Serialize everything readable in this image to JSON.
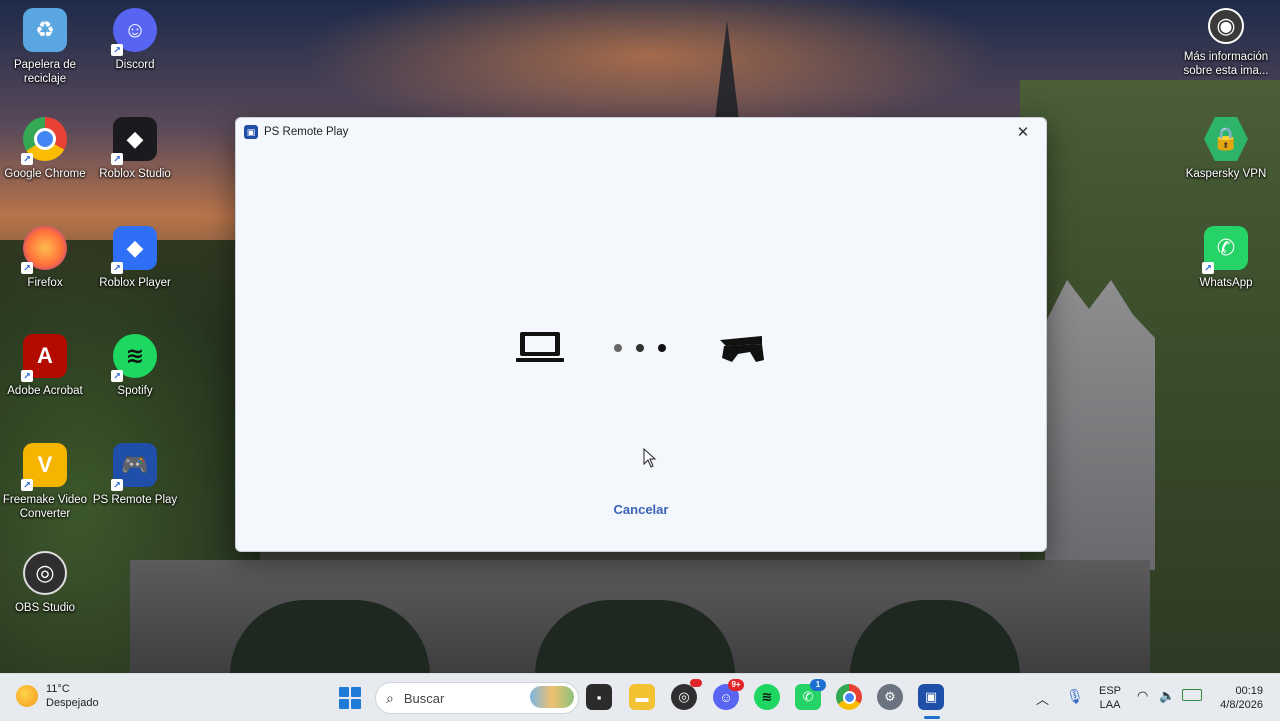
{
  "desktop": {
    "icons_left": [
      {
        "label": "Papelera de reciclaje",
        "icon": "recycle-bin-icon",
        "color": "#5aa6e0"
      },
      {
        "label": "Discord",
        "icon": "discord-icon",
        "color": "#5865F2"
      },
      {
        "label": "Google Chrome",
        "icon": "chrome-icon",
        "color": "#e94235"
      },
      {
        "label": "Roblox Studio",
        "icon": "roblox-studio-icon",
        "color": "#1b1b1f"
      },
      {
        "label": "Firefox",
        "icon": "firefox-icon",
        "color": "#ff7139"
      },
      {
        "label": "Roblox Player",
        "icon": "roblox-player-icon",
        "color": "#2f6ff5"
      },
      {
        "label": "Adobe Acrobat",
        "icon": "acrobat-icon",
        "color": "#b30b00"
      },
      {
        "label": "Spotify",
        "icon": "spotify-icon",
        "color": "#1ed760"
      },
      {
        "label": "Freemake Video Converter",
        "icon": "freemake-icon",
        "color": "#f5b400"
      },
      {
        "label": "PS Remote Play",
        "icon": "ps-remote-play-icon",
        "color": "#1f4fa8"
      },
      {
        "label": "OBS Studio",
        "icon": "obs-icon",
        "color": "#302e31"
      }
    ],
    "icons_right": [
      {
        "label": "Más información sobre esta ima...",
        "icon": "info-camera-icon",
        "color": "#3a3a3a"
      },
      {
        "label": "Kaspersky VPN",
        "icon": "kaspersky-vpn-icon",
        "color": "#2db46a"
      },
      {
        "label": "WhatsApp",
        "icon": "whatsapp-icon",
        "color": "#25d366"
      }
    ]
  },
  "window": {
    "title": "PS Remote Play",
    "close_glyph": "✕",
    "cancel_label": "Cancelar",
    "accent": "#3a64b5"
  },
  "taskbar": {
    "weather_temp": "11°C",
    "weather_desc": "Despejado",
    "search_placeholder": "Buscar",
    "apps": [
      {
        "name": "file-explorer-icon"
      },
      {
        "name": "folder-icon"
      },
      {
        "name": "obs-taskbar-icon"
      },
      {
        "name": "discord-taskbar-icon",
        "badge": "9+"
      },
      {
        "name": "spotify-taskbar-icon"
      },
      {
        "name": "whatsapp-taskbar-icon",
        "badge": "1"
      },
      {
        "name": "chrome-taskbar-icon"
      },
      {
        "name": "settings-taskbar-icon"
      },
      {
        "name": "ps-remote-play-taskbar-icon"
      }
    ],
    "lang_top": "ESP",
    "lang_bottom": "LAA",
    "time": "00:19",
    "date": "4/8/2026"
  }
}
